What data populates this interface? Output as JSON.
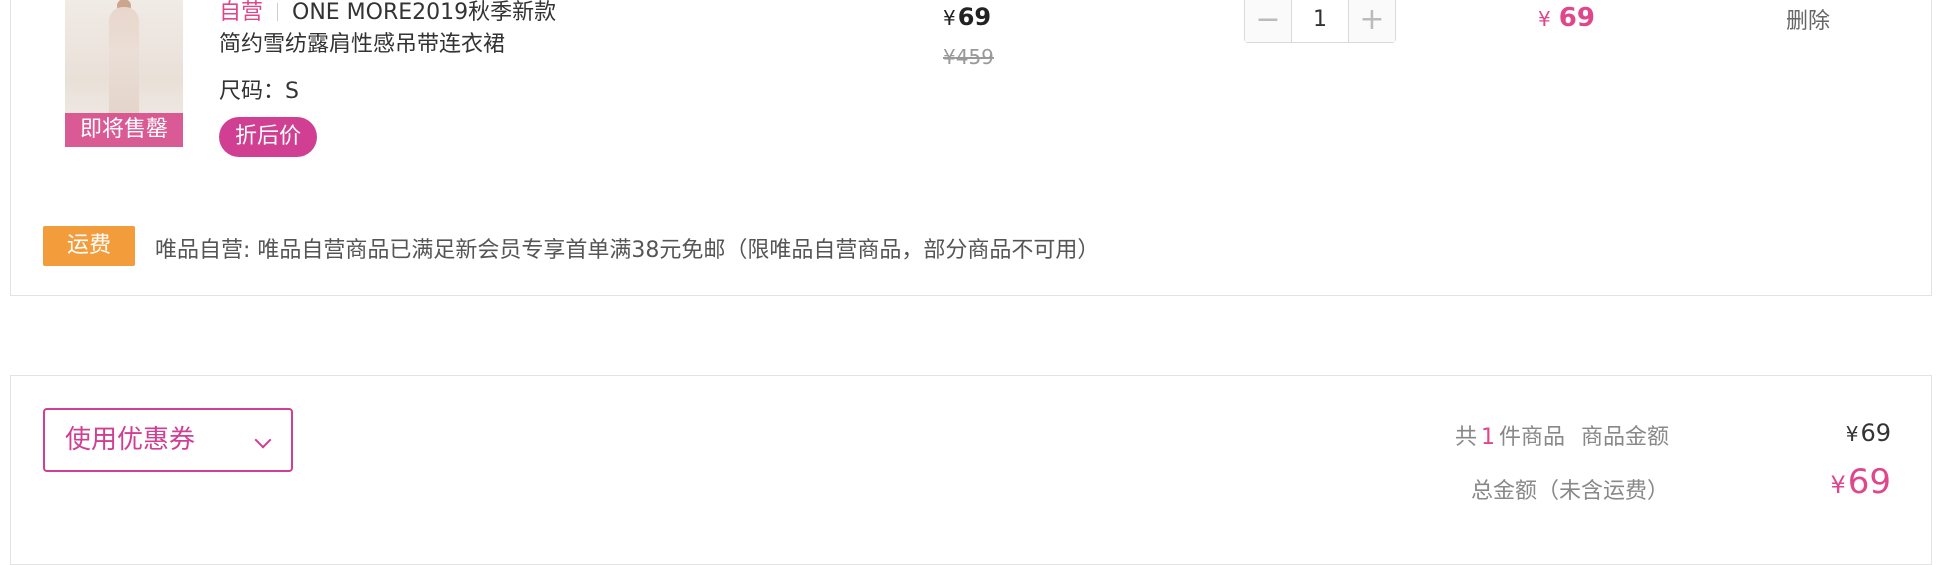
{
  "item": {
    "image_badge": "即将售罄",
    "self_operated_tag": "自营",
    "title_line1": "ONE MORE2019秋季新款",
    "title_line2": "简约雪纺露肩性感吊带连衣裙",
    "size": "尺码：S",
    "discount_tag": "折后价",
    "currency": "¥",
    "price": "69",
    "original_price": "459",
    "quantity": "1",
    "quantity_minus_icon": "minus-icon",
    "quantity_plus_icon": "plus-icon",
    "subtotal": "69",
    "delete_label": "删除"
  },
  "shipping": {
    "badge": "运费",
    "text": "唯品自营: 唯品自营商品已满足新会员专享首单满38元免邮（限唯品自营商品，部分商品不可用）"
  },
  "summary": {
    "coupon_label": "使用优惠券",
    "coupon_icon": "chevron-down-icon",
    "count_prefix": "共",
    "count": "1",
    "count_suffix": "件商品",
    "goods_amount_label": "商品金额",
    "currency": "¥",
    "goods_amount": "69",
    "total_label": "总金额（未含运费）",
    "total_amount": "69"
  },
  "colors": {
    "accent": "#d03f92",
    "price_accent": "#e0468b",
    "shipping_badge": "#f39c3c",
    "border": "#e3e3e3"
  }
}
